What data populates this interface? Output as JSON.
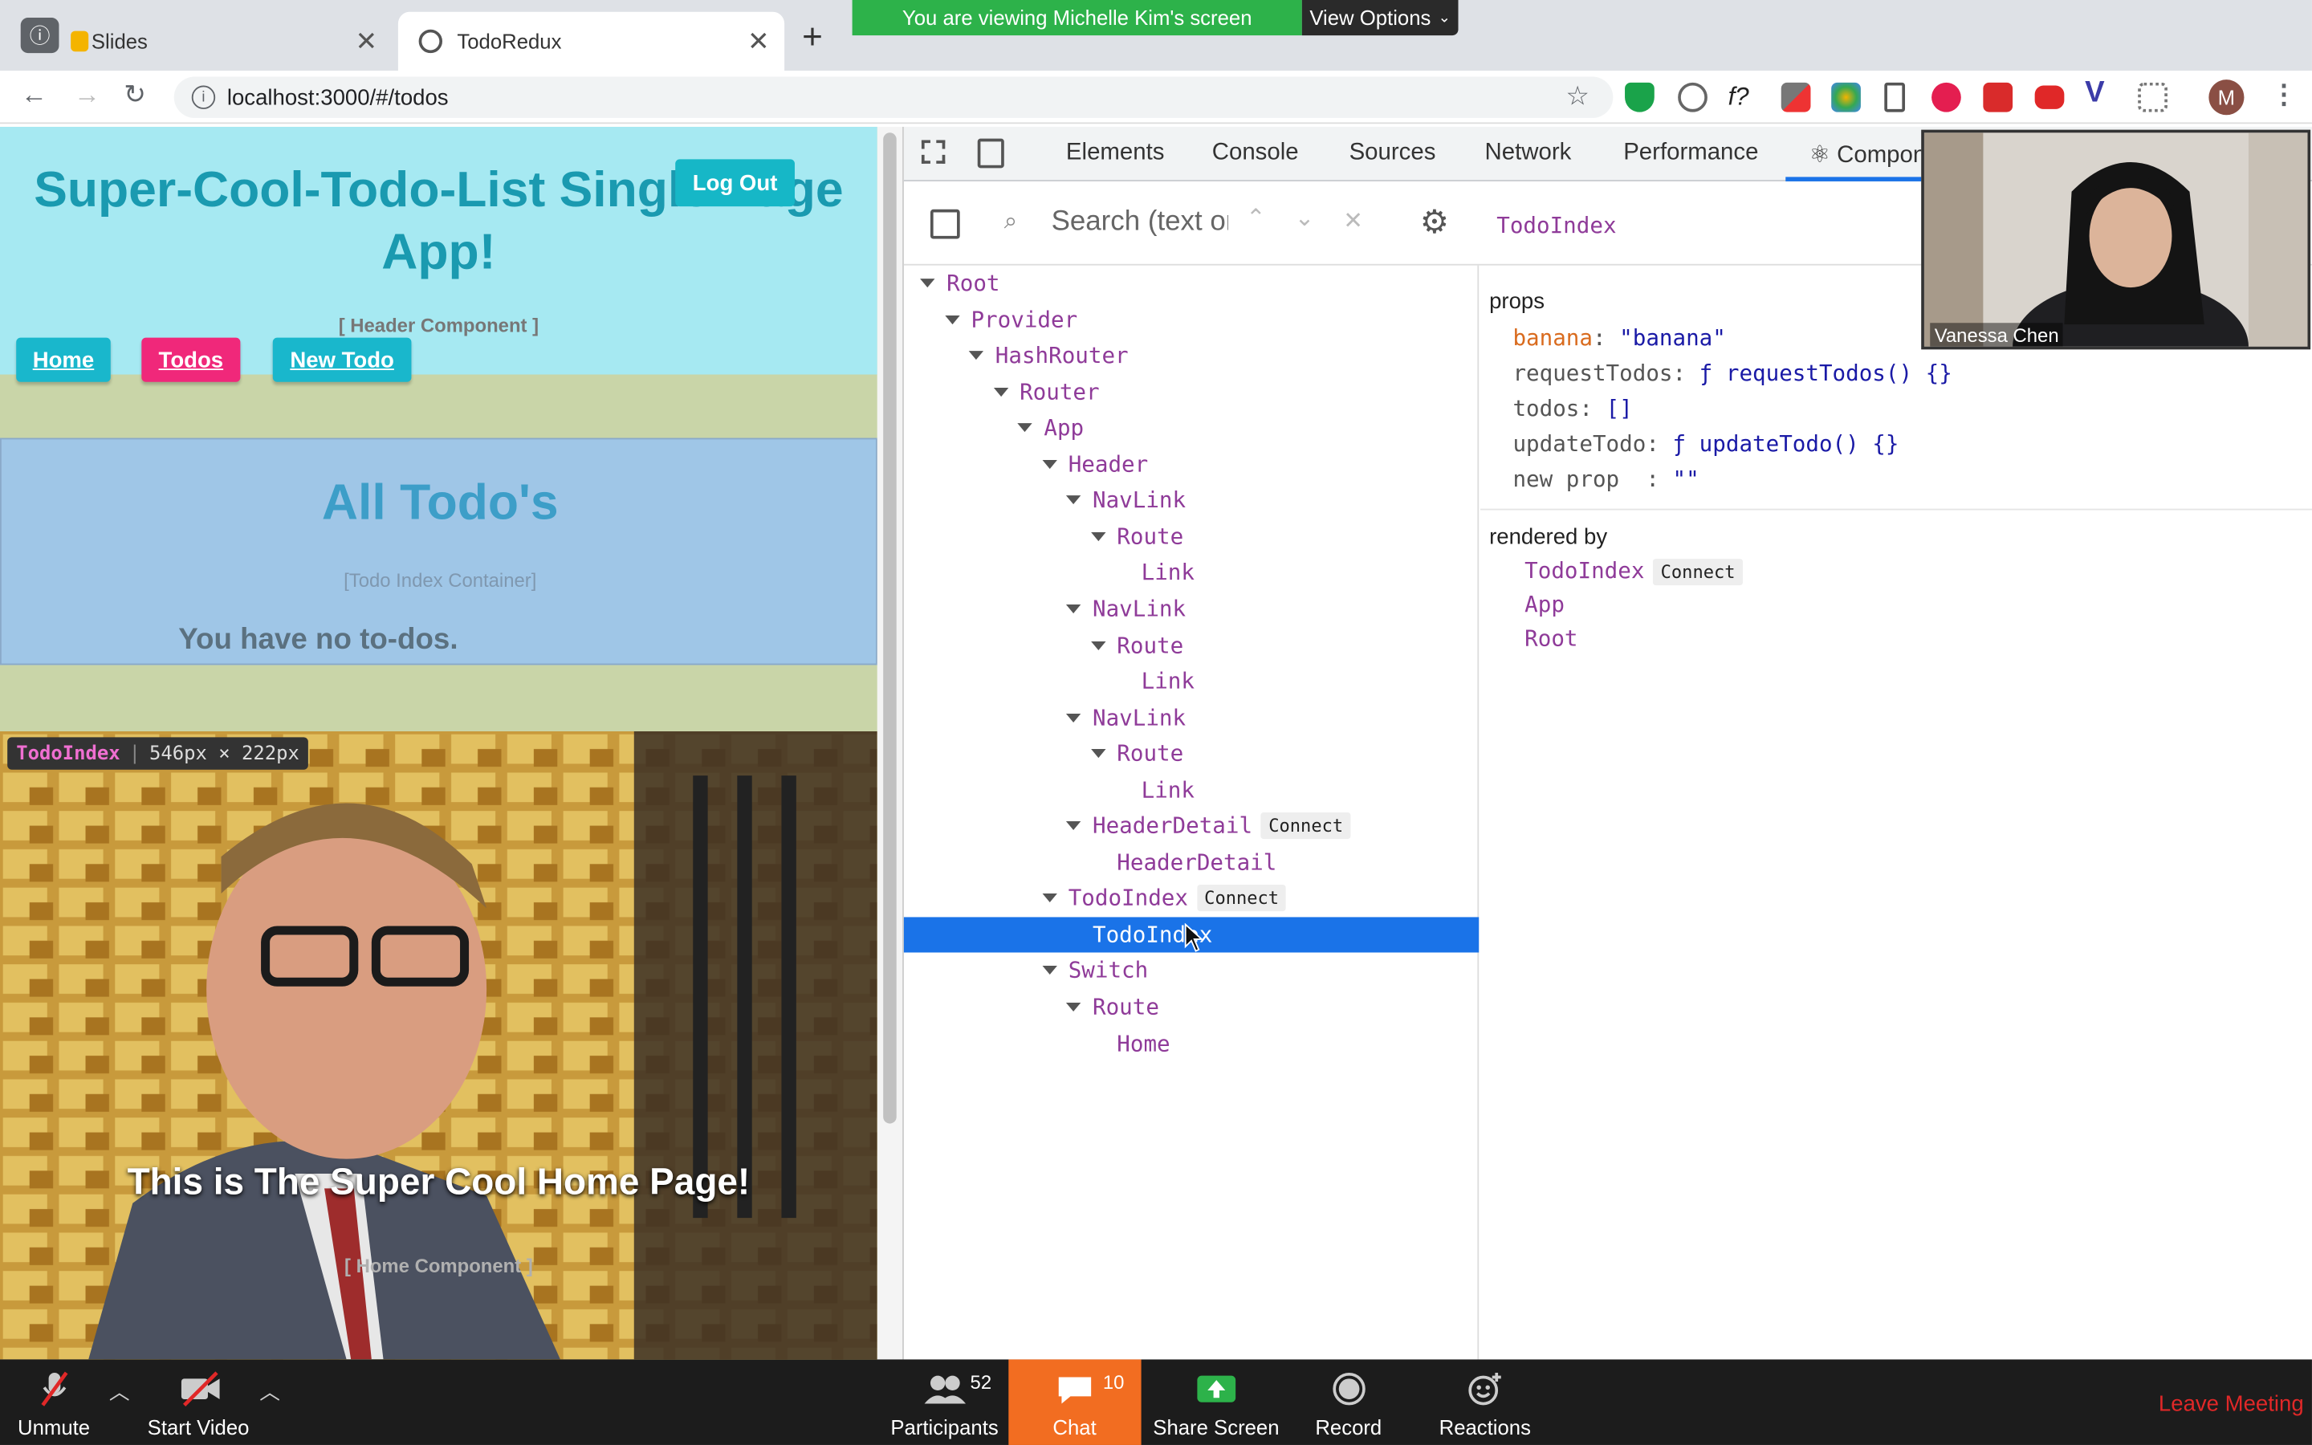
{
  "browser": {
    "tabs": [
      {
        "label": "Slides"
      },
      {
        "label": "TodoRedux"
      }
    ],
    "new_tab": "+",
    "url": "localhost:3000/#/todos",
    "profile_initial": "M"
  },
  "sharing": {
    "banner": "You are viewing Michelle Kim's screen",
    "view_options": "View Options"
  },
  "page": {
    "title": "Super-Cool-Todo-List Single Page App!",
    "logout": "Log Out",
    "header_label": "[ Header Component ]",
    "nav": [
      {
        "label": "Home",
        "color": "#19b7cc"
      },
      {
        "label": "Todos",
        "color": "#f0287a"
      },
      {
        "label": "New Todo",
        "color": "#19b7cc"
      }
    ],
    "todos_heading": "All Todo's",
    "todos_label": "[Todo Index Container]",
    "empty_message": "You have no to-dos.",
    "inspect_name": "TodoIndex",
    "inspect_size": "546px × 222px",
    "home_heading": "This is The Super Cool Home Page!",
    "home_label": "[ Home Component ]"
  },
  "devtools": {
    "tabs": [
      "Elements",
      "Console",
      "Sources",
      "Network",
      "Performance",
      "⚛ Components"
    ],
    "search_placeholder": "Search (text or /regex/)",
    "selected_component": "TodoIndex",
    "tree": [
      {
        "name": "Root",
        "depth": 0,
        "expanded": true
      },
      {
        "name": "Provider",
        "depth": 1,
        "expanded": true
      },
      {
        "name": "HashRouter",
        "depth": 2,
        "expanded": true
      },
      {
        "name": "Router",
        "depth": 3,
        "expanded": true
      },
      {
        "name": "App",
        "depth": 4,
        "expanded": true
      },
      {
        "name": "Header",
        "depth": 5,
        "expanded": true
      },
      {
        "name": "NavLink",
        "depth": 6,
        "expanded": true
      },
      {
        "name": "Route",
        "depth": 7,
        "expanded": true
      },
      {
        "name": "Link",
        "depth": 8,
        "expanded": false
      },
      {
        "name": "NavLink",
        "depth": 6,
        "expanded": true
      },
      {
        "name": "Route",
        "depth": 7,
        "expanded": true
      },
      {
        "name": "Link",
        "depth": 8,
        "expanded": false
      },
      {
        "name": "NavLink",
        "depth": 6,
        "expanded": true
      },
      {
        "name": "Route",
        "depth": 7,
        "expanded": true
      },
      {
        "name": "Link",
        "depth": 8,
        "expanded": false
      },
      {
        "name": "HeaderDetail",
        "depth": 6,
        "expanded": true,
        "badge": "Connect"
      },
      {
        "name": "HeaderDetail",
        "depth": 7,
        "expanded": false
      },
      {
        "name": "TodoIndex",
        "depth": 5,
        "expanded": true,
        "badge": "Connect"
      },
      {
        "name": "TodoIndex",
        "depth": 6,
        "expanded": false,
        "selected": true
      },
      {
        "name": "Switch",
        "depth": 5,
        "expanded": true
      },
      {
        "name": "Route",
        "depth": 6,
        "expanded": true
      },
      {
        "name": "Home",
        "depth": 7,
        "expanded": false
      }
    ],
    "props_heading": "props",
    "props": [
      {
        "key": "banana",
        "value": "\"banana\"",
        "highlight": true
      },
      {
        "key": "requestTodos",
        "value": "ƒ requestTodos() {}"
      },
      {
        "key": "todos",
        "value": "[]"
      },
      {
        "key": "updateTodo",
        "value": "ƒ updateTodo() {}"
      },
      {
        "key": "new prop",
        "value": "\"\"",
        "new": true
      }
    ],
    "rendered_by_heading": "rendered by",
    "rendered_by": [
      {
        "name": "TodoIndex",
        "badge": "Connect"
      },
      {
        "name": "App"
      },
      {
        "name": "Root"
      }
    ]
  },
  "video": {
    "participant_name": "Vanessa Chen"
  },
  "zoom": {
    "unmute": "Unmute",
    "start_video": "Start Video",
    "participants": "Participants",
    "participants_count": "52",
    "chat": "Chat",
    "chat_count": "10",
    "share_screen": "Share Screen",
    "record": "Record",
    "reactions": "Reactions",
    "leave": "Leave Meeting"
  },
  "colors": {
    "accent_blue": "#1a73e8",
    "selected_row": "#1a73e8",
    "share_green": "#2db24a",
    "chat_orange": "#f26d21",
    "leave_red": "#e02828"
  }
}
